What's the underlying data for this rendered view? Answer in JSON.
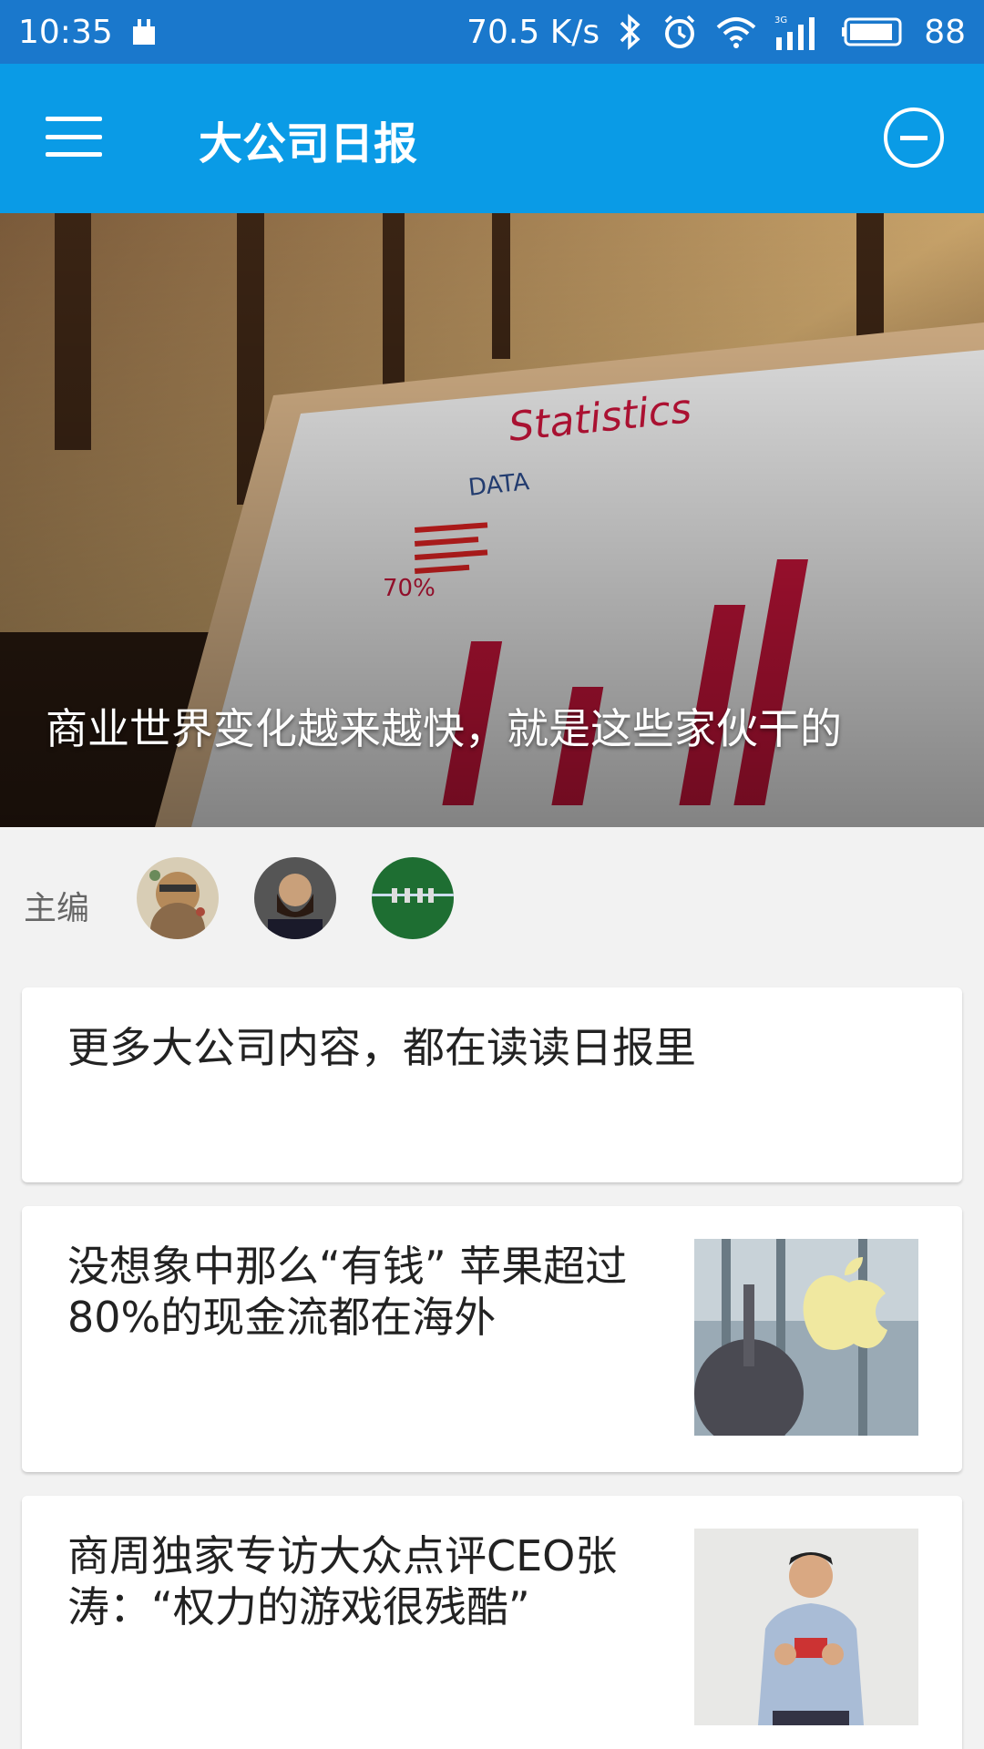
{
  "status_bar": {
    "time": "10:35",
    "speed": "70.5 K/s",
    "network": "3G",
    "battery": "88",
    "icons": [
      "notification-icon",
      "bluetooth-icon",
      "alarm-icon",
      "wifi-icon",
      "signal-icon",
      "battery-icon"
    ]
  },
  "app_bar": {
    "title": "大公司日报",
    "menu_icon": "hamburger-menu-icon",
    "action_icon": "minus-circle-icon"
  },
  "hero": {
    "caption": "商业世界变化越来越快，就是这些家伙干的"
  },
  "editors": {
    "label": "主编",
    "avatars": [
      "avatar-1",
      "avatar-2",
      "avatar-3"
    ]
  },
  "articles": [
    {
      "title": "更多大公司内容，都在读读日报里",
      "has_thumbnail": false
    },
    {
      "title_line1": "没想象中那么“有钱” 苹果超过",
      "title_line2": "80%的现金流都在海外",
      "has_thumbnail": true,
      "thumbnail": "apple-store-image"
    },
    {
      "title_line1": "商周独家专访大众点评CEO张",
      "title_line2": "涛：“权力的游戏很残酷”",
      "has_thumbnail": true,
      "thumbnail": "ceo-portrait-image"
    }
  ],
  "colors": {
    "status_bar": "#1a78cc",
    "app_bar": "#0a9be6",
    "background": "#f2f2f2",
    "card": "#ffffff"
  }
}
